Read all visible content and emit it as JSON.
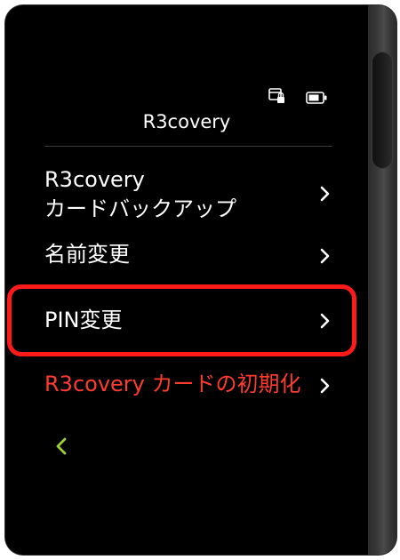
{
  "header": {
    "title": "R3covery",
    "status_icons": [
      "card-lock-icon",
      "battery-icon"
    ]
  },
  "menu": {
    "items": [
      {
        "lines": [
          "R3covery",
          "カードバックアップ"
        ],
        "icon": "chevron-right-icon"
      },
      {
        "label": "名前変更",
        "icon": "chevron-right-icon"
      },
      {
        "label": "PIN変更",
        "icon": "chevron-right-icon",
        "highlighted": true
      },
      {
        "label": "R3covery カードの初期化",
        "icon": "chevron-right-icon",
        "color": "#ff3b30"
      }
    ]
  },
  "back": {
    "icon": "chevron-left-icon",
    "color": "#9ccf3a"
  },
  "colors": {
    "screen_bg": "#000000",
    "text": "#ffffff",
    "danger": "#ff3b30",
    "highlight": "#ff1a1a",
    "back_accent": "#9ccf3a"
  }
}
